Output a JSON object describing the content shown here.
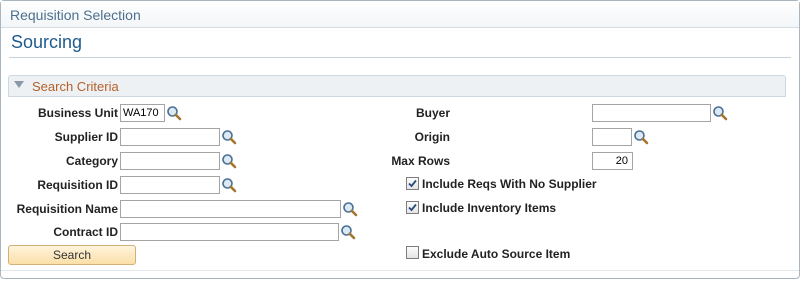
{
  "page": {
    "title": "Requisition Selection",
    "subtitle": "Sourcing"
  },
  "section": {
    "title": "Search Criteria",
    "expanded": true
  },
  "fields": {
    "business_unit": {
      "label": "Business Unit",
      "value": "WA170"
    },
    "supplier_id": {
      "label": "Supplier ID",
      "value": ""
    },
    "category": {
      "label": "Category",
      "value": ""
    },
    "requisition_id": {
      "label": "Requisition ID",
      "value": ""
    },
    "requisition_name": {
      "label": "Requisition Name",
      "value": ""
    },
    "contract_id": {
      "label": "Contract ID",
      "value": ""
    },
    "buyer": {
      "label": "Buyer",
      "value": ""
    },
    "origin": {
      "label": "Origin",
      "value": ""
    },
    "max_rows": {
      "label": "Max Rows",
      "value": "20"
    }
  },
  "checkboxes": {
    "include_no_supplier": {
      "label": "Include Reqs With No Supplier",
      "checked": true
    },
    "include_inventory": {
      "label": "Include Inventory Items",
      "checked": true
    },
    "exclude_auto_source": {
      "label": "Exclude Auto Source Item",
      "checked": false
    }
  },
  "buttons": {
    "search_label": "Search"
  },
  "icons": {
    "lookup": "magnifier-lookup-icon",
    "section_toggle": "triangle-down-icon",
    "checkmark": "checkmark-icon"
  },
  "colors": {
    "title": "#4c6f8e",
    "subtitle": "#1f5b8c",
    "section_title": "#b5612a",
    "button_bg": "#fbdfa8"
  }
}
